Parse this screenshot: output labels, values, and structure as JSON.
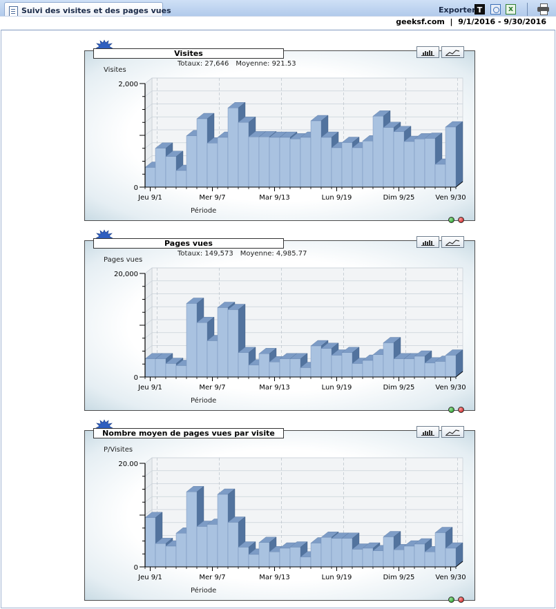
{
  "header": {
    "title": "Suivi des visites et des pages vues",
    "export_label": "Exporter",
    "export_text_icon_label": "T",
    "subtitle": "geeksf.com  |  9/1/2016 - 9/30/2016"
  },
  "colors": {
    "bar_front": "#a9c2e0",
    "bar_top": "#7d9cc6",
    "bar_side": "#52739e",
    "grid": "#c8d0d8",
    "accent_burst": "#2f5fc0"
  },
  "chart_data": [
    {
      "type": "bar",
      "title": "Visites",
      "totals_label": "Totaux: 27,646",
      "average_label": "Moyenne: 921.53",
      "ylabel": "Visites",
      "xlabel": "Période",
      "ylim": [
        0,
        2000
      ],
      "ytick_labels": [
        "2,000",
        "0"
      ],
      "xtick_labels": [
        "Jeu 9/1",
        "Mer 9/7",
        "Mar 9/13",
        "Lun 9/19",
        "Dim 9/25",
        "Ven 9/30"
      ],
      "xtick_indices": [
        0,
        6,
        12,
        18,
        24,
        29
      ],
      "categories": [
        "9/1",
        "9/2",
        "9/3",
        "9/4",
        "9/5",
        "9/6",
        "9/7",
        "9/8",
        "9/9",
        "9/10",
        "9/11",
        "9/12",
        "9/13",
        "9/14",
        "9/15",
        "9/16",
        "9/17",
        "9/18",
        "9/19",
        "9/20",
        "9/21",
        "9/22",
        "9/23",
        "9/24",
        "9/25",
        "9/26",
        "9/27",
        "9/28",
        "9/29",
        "9/30"
      ],
      "values": [
        380,
        750,
        590,
        320,
        990,
        1320,
        850,
        960,
        1530,
        1250,
        970,
        970,
        960,
        960,
        930,
        960,
        1280,
        960,
        760,
        860,
        760,
        890,
        1370,
        1150,
        1070,
        880,
        930,
        940,
        440,
        1160
      ]
    },
    {
      "type": "bar",
      "title": "Pages vues",
      "totals_label": "Totaux: 149,573",
      "average_label": "Moyenne: 4,985.77",
      "ylabel": "Pages vues",
      "xlabel": "Période",
      "ylim": [
        0,
        20000
      ],
      "ytick_labels": [
        "20,000",
        "0"
      ],
      "xtick_labels": [
        "Jeu 9/1",
        "Mer 9/7",
        "Mar 9/13",
        "Lun 9/19",
        "Dim 9/25",
        "Ven 9/30"
      ],
      "xtick_indices": [
        0,
        6,
        12,
        18,
        24,
        29
      ],
      "categories": [
        "9/1",
        "9/2",
        "9/3",
        "9/4",
        "9/5",
        "9/6",
        "9/7",
        "9/8",
        "9/9",
        "9/10",
        "9/11",
        "9/12",
        "9/13",
        "9/14",
        "9/15",
        "9/16",
        "9/17",
        "9/18",
        "9/19",
        "9/20",
        "9/21",
        "9/22",
        "9/23",
        "9/24",
        "9/25",
        "9/26",
        "9/27",
        "9/28",
        "9/29",
        "9/30"
      ],
      "values": [
        3500,
        3500,
        2600,
        2200,
        14200,
        10500,
        7000,
        13400,
        13000,
        4700,
        2300,
        4500,
        2900,
        3500,
        3500,
        1800,
        6000,
        5500,
        4200,
        4700,
        2600,
        3200,
        4300,
        6600,
        3500,
        3500,
        4000,
        2700,
        3000,
        4200
      ]
    },
    {
      "type": "bar",
      "title": "Nombre moyen de pages vues par visite",
      "ylabel": "P/Visites",
      "xlabel": "Période",
      "ylim": [
        0,
        20
      ],
      "ytick_labels": [
        "20.00",
        "0"
      ],
      "xtick_labels": [
        "Jeu 9/1",
        "Mer 9/7",
        "Mar 9/13",
        "Lun 9/19",
        "Dim 9/25",
        "Ven 9/30"
      ],
      "xtick_indices": [
        0,
        6,
        12,
        18,
        24,
        29
      ],
      "categories": [
        "9/1",
        "9/2",
        "9/3",
        "9/4",
        "9/5",
        "9/6",
        "9/7",
        "9/8",
        "9/9",
        "9/10",
        "9/11",
        "9/12",
        "9/13",
        "9/14",
        "9/15",
        "9/16",
        "9/17",
        "9/18",
        "9/19",
        "9/20",
        "9/21",
        "9/22",
        "9/23",
        "9/24",
        "9/25",
        "9/26",
        "9/27",
        "9/28",
        "9/29",
        "9/30"
      ],
      "values": [
        9.5,
        4.5,
        4.0,
        6.5,
        14.5,
        7.8,
        8.2,
        14.0,
        8.6,
        3.8,
        2.4,
        4.7,
        2.9,
        3.6,
        3.8,
        1.9,
        4.6,
        5.7,
        5.5,
        5.5,
        3.4,
        3.6,
        3.1,
        5.8,
        3.3,
        4.0,
        4.4,
        2.9,
        6.6,
        3.6
      ]
    }
  ]
}
